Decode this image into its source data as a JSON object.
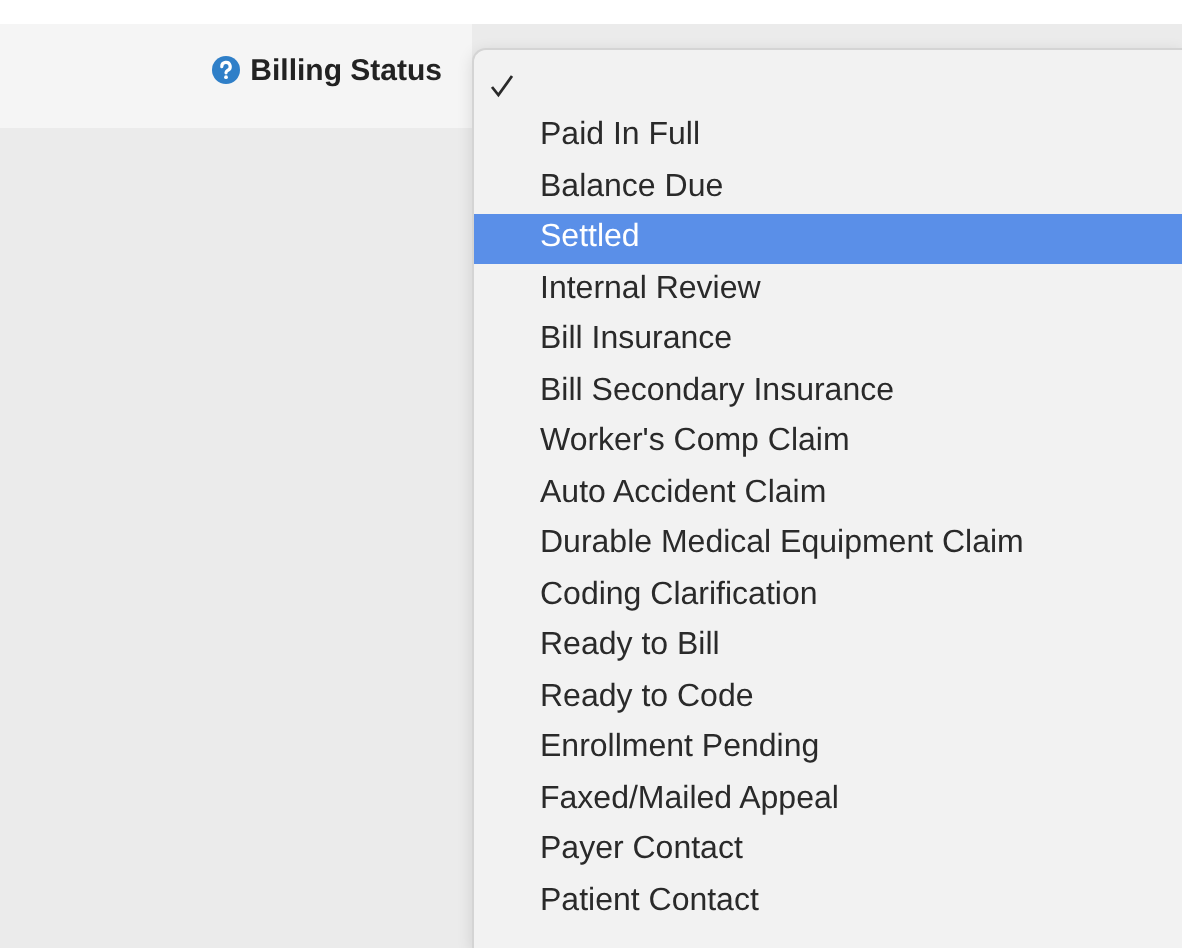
{
  "field": {
    "label": "Billing Status"
  },
  "options": [
    {
      "checked": true,
      "selected": false
    },
    {
      "label": "Paid In Full",
      "checked": false,
      "selected": false
    },
    {
      "label": "Balance Due",
      "checked": false,
      "selected": false
    },
    {
      "label": "Settled",
      "checked": false,
      "selected": true
    },
    {
      "label": "Internal Review",
      "checked": false,
      "selected": false
    },
    {
      "label": "Bill Insurance",
      "checked": false,
      "selected": false
    },
    {
      "label": "Bill Secondary Insurance",
      "checked": false,
      "selected": false
    },
    {
      "label": "Worker's Comp Claim",
      "checked": false,
      "selected": false
    },
    {
      "label": "Auto Accident Claim",
      "checked": false,
      "selected": false
    },
    {
      "label": "Durable Medical Equipment Claim",
      "checked": false,
      "selected": false
    },
    {
      "label": "Coding Clarification",
      "checked": false,
      "selected": false
    },
    {
      "label": "Ready to Bill",
      "checked": false,
      "selected": false
    },
    {
      "label": "Ready to Code",
      "checked": false,
      "selected": false
    },
    {
      "label": "Enrollment Pending",
      "checked": false,
      "selected": false
    },
    {
      "label": "Faxed/Mailed Appeal",
      "checked": false,
      "selected": false
    },
    {
      "label": "Payer Contact",
      "checked": false,
      "selected": false
    },
    {
      "label": "Patient Contact",
      "checked": false,
      "selected": false
    }
  ]
}
